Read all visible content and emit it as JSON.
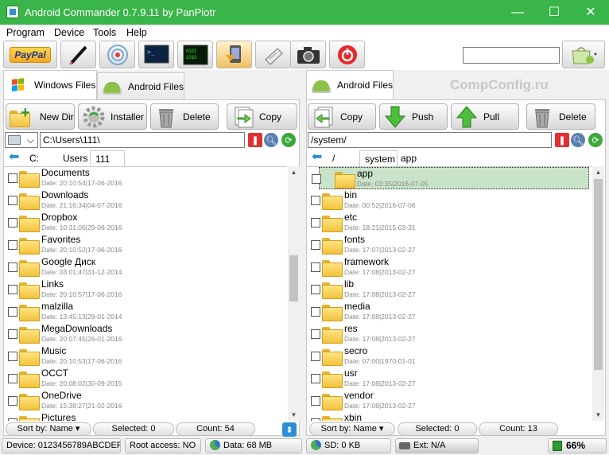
{
  "window": {
    "title": "Android Commander 0.7.9.11 by PanPiotr",
    "minimize": "—",
    "maximize": "☐",
    "close": "✕"
  },
  "menu": [
    "Program",
    "Device",
    "Tools",
    "Help"
  ],
  "toolbar": {
    "icons": [
      "paypal-icon",
      "pen-icon",
      "wireless-icon",
      "terminal-icon",
      "matrix-icon",
      "install-icon",
      "keyboard-icon",
      "camera-icon",
      "power-icon",
      "shopping-bag-icon"
    ],
    "paypal_label": "PayPal",
    "search_value": ""
  },
  "watermark": "CompConfig.ru",
  "left": {
    "tabs": [
      "Windows Files",
      "Android Files"
    ],
    "active_tab": 0,
    "buttons": [
      "New Dir",
      "Installer",
      "Delete",
      "Copy"
    ],
    "path": "C:\\Users\\111\\",
    "drive": "",
    "crumbs": [
      "C:",
      "Users",
      "111"
    ],
    "files": [
      {
        "name": "Documents",
        "date": "Date: 20:10:54|17-06-2016"
      },
      {
        "name": "Downloads",
        "date": "Date: 21:16:34|04-07-2016"
      },
      {
        "name": "Dropbox",
        "date": "Date: 10:31:06|29-06-2016"
      },
      {
        "name": "Favorites",
        "date": "Date: 20:10:52|17-06-2016"
      },
      {
        "name": "Google Диск",
        "date": "Date: 03:01:47|31-12-2014"
      },
      {
        "name": "Links",
        "date": "Date: 20:10:57|17-06-2016"
      },
      {
        "name": "malzilla",
        "date": "Date: 13:45:13|29-01-2014"
      },
      {
        "name": "MegaDownloads",
        "date": "Date: 20:07:45|26-01-2016"
      },
      {
        "name": "Music",
        "date": "Date: 20:10:53|17-06-2016"
      },
      {
        "name": "OCCT",
        "date": "Date: 20:08:02|30-09-2015"
      },
      {
        "name": "OneDrive",
        "date": "Date: 15:38:27|21-02-2016"
      },
      {
        "name": "Pictures",
        "date": ""
      }
    ],
    "sort": "Sort by: Name ▾",
    "selected": "Selected: 0",
    "count": "Count: 54"
  },
  "right": {
    "tabs": [
      "Android Files"
    ],
    "buttons": [
      "Copy",
      "Push",
      "Pull",
      "Delete"
    ],
    "path": "/system/",
    "crumbs": [
      "/",
      "system",
      "app"
    ],
    "files": [
      {
        "name": "app",
        "date": "Date: 03:35|2016-07-05"
      },
      {
        "name": "bin",
        "date": "Date: 00:52|2016-07-06"
      },
      {
        "name": "etc",
        "date": "Date: 18:21|2015-03-31"
      },
      {
        "name": "fonts",
        "date": "Date: 17:07|2013-02-27"
      },
      {
        "name": "framework",
        "date": "Date: 17:08|2013-02-27"
      },
      {
        "name": "lib",
        "date": "Date: 17:08|2013-02-27"
      },
      {
        "name": "media",
        "date": "Date: 17:08|2013-02-27"
      },
      {
        "name": "res",
        "date": "Date: 17:08|2013-02-27"
      },
      {
        "name": "secro",
        "date": "Date: 07:00|1970-01-01"
      },
      {
        "name": "usr",
        "date": "Date: 17:08|2013-02-27"
      },
      {
        "name": "vendor",
        "date": "Date: 17:08|2013-02-27"
      },
      {
        "name": "xbin",
        "date": ""
      }
    ],
    "sort": "Sort by: Name ▾",
    "selected": "Selected: 0",
    "count": "Count: 13"
  },
  "status": {
    "device": "Device: 0123456789ABCDEF",
    "root": "Root access: NO",
    "data": "Data: 68 MB",
    "sd": "SD: 0 KB",
    "ext": "Ext: N/A",
    "battery": "66%"
  },
  "colors": {
    "titlebar": "#39b54a",
    "selection": "#c9e3c9",
    "accent": "#2d8cd6"
  }
}
